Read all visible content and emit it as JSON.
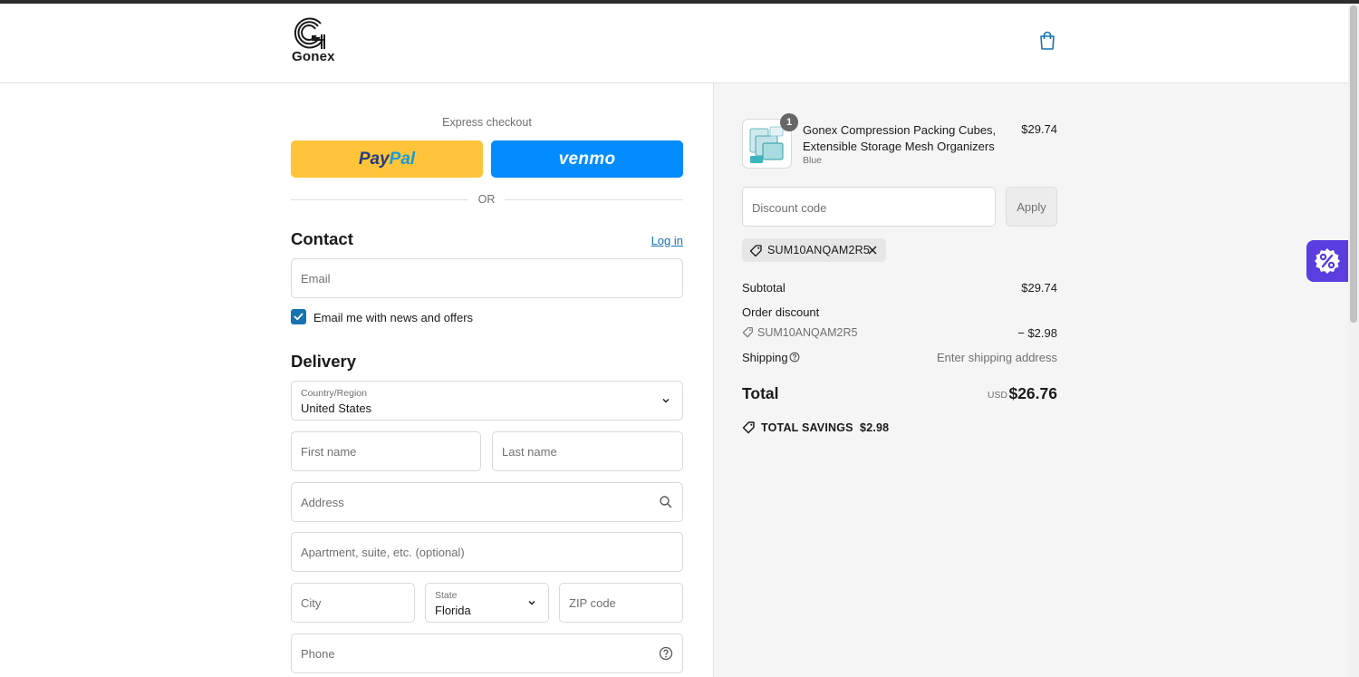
{
  "header": {
    "brand": "Gonex",
    "cart_icon": "shopping-bag-icon"
  },
  "express": {
    "label": "Express checkout",
    "paypal": {
      "part1": "Pay",
      "part2": "Pal",
      "color": "#ffc439"
    },
    "venmo": {
      "label": "venmo",
      "color": "#008cff"
    },
    "or_label": "OR"
  },
  "contact": {
    "title": "Contact",
    "login_label": "Log in",
    "email_placeholder": "Email",
    "newsletter_label": "Email me with news and offers",
    "newsletter_checked": true
  },
  "delivery": {
    "title": "Delivery",
    "country_label": "Country/Region",
    "country_value": "United States",
    "first_name_placeholder": "First name",
    "last_name_placeholder": "Last name",
    "address_placeholder": "Address",
    "apartment_placeholder": "Apartment, suite, etc. (optional)",
    "city_placeholder": "City",
    "state_label": "State",
    "state_value": "Florida",
    "zip_placeholder": "ZIP code",
    "phone_placeholder": "Phone"
  },
  "summary": {
    "product": {
      "title": "Gonex Compression Packing Cubes, Extensible Storage Mesh Organizers",
      "variant": "Blue",
      "price": "$29.74",
      "quantity": "1"
    },
    "discount_placeholder": "Discount code",
    "apply_label": "Apply",
    "applied_code": "SUM10ANQAM2R5",
    "subtotal_label": "Subtotal",
    "subtotal_value": "$29.74",
    "order_discount_label": "Order discount",
    "order_discount_code": "SUM10ANQAM2R5",
    "order_discount_value": "− $2.98",
    "shipping_label": "Shipping",
    "shipping_value": "Enter shipping address",
    "total_label": "Total",
    "total_currency": "USD",
    "total_value": "$26.76",
    "savings_label": "TOTAL SAVINGS",
    "savings_value": "$2.98"
  },
  "colors": {
    "accent": "#1773b0",
    "promo_widget": "#5b3de0"
  }
}
